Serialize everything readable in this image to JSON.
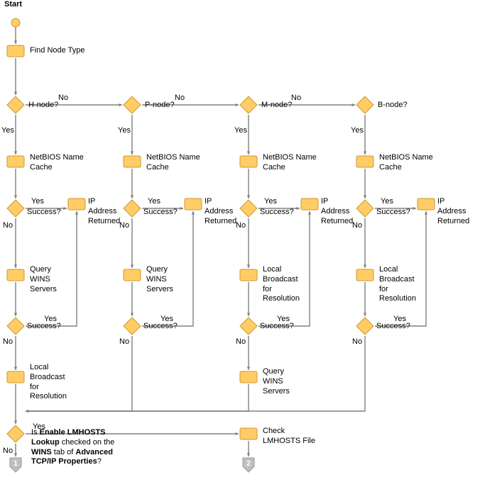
{
  "title": "Start",
  "steps": {
    "find_node_type": "Find Node Type",
    "h_node_q": "H-node?",
    "p_node_q": "P-node?",
    "m_node_q": "M-node?",
    "b_node_q": "B-node?",
    "nbt_cache": "NetBIOS Name\nCache",
    "success_q": "Success?",
    "ip_returned": "IP\nAddress\nReturned",
    "query_wins": "Query\nWINS\nServers",
    "local_broadcast": "Local\nBroadcast\nfor\nResolution",
    "lmhosts_q": "Is Enable LMHOSTS\nLookup checked on the\nWINS tab of Advanced\nTCP/IP Properties?",
    "check_lmhosts": "Check\nLMHOSTS File"
  },
  "edge_labels": {
    "yes": "Yes",
    "no": "No"
  },
  "connectors": {
    "a": "1",
    "b": "2"
  },
  "style": {
    "fill": "#ffcc66",
    "stroke": "#cc9933",
    "arrow": "#808080",
    "text": "#000000"
  }
}
